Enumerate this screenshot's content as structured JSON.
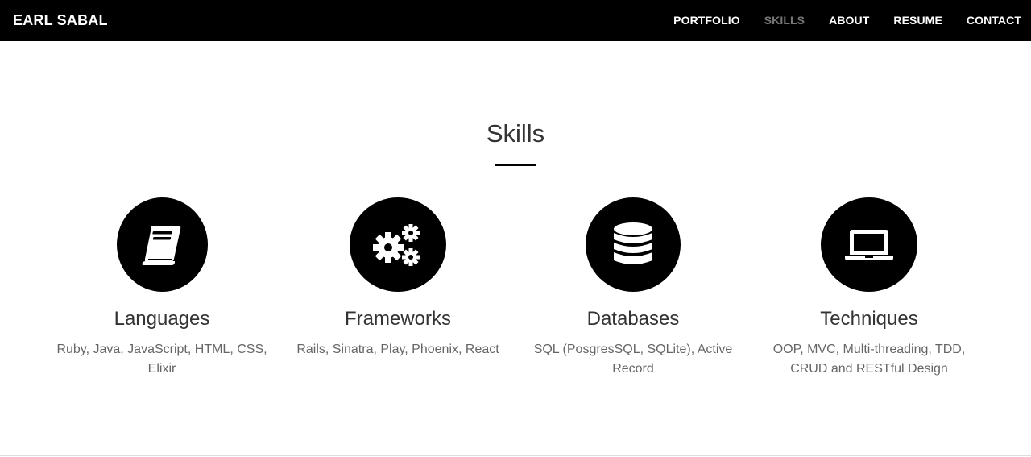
{
  "nav": {
    "brand": "EARL SABAL",
    "links": [
      {
        "label": "PORTFOLIO"
      },
      {
        "label": "SKILLS"
      },
      {
        "label": "ABOUT"
      },
      {
        "label": "RESUME"
      },
      {
        "label": "CONTACT"
      }
    ],
    "active_link": "SKILLS"
  },
  "section": {
    "title": "Skills"
  },
  "skills": [
    {
      "name": "Languages",
      "description": "Ruby, Java, JavaScript, HTML, CSS, Elixir",
      "icon": "book-icon"
    },
    {
      "name": "Frameworks",
      "description": "Rails, Sinatra, Play, Phoenix, React",
      "icon": "gears-icon"
    },
    {
      "name": "Databases",
      "description": "SQL (PosgresSQL, SQLite), Active Record",
      "icon": "database-icon"
    },
    {
      "name": "Techniques",
      "description": "OOP, MVC, Multi-threading, TDD, CRUD and RESTful Design",
      "icon": "laptop-icon"
    }
  ],
  "colors": {
    "navbar_bg": "#000000",
    "nav_active": "#777777",
    "text": "#333333",
    "muted": "#666666"
  }
}
